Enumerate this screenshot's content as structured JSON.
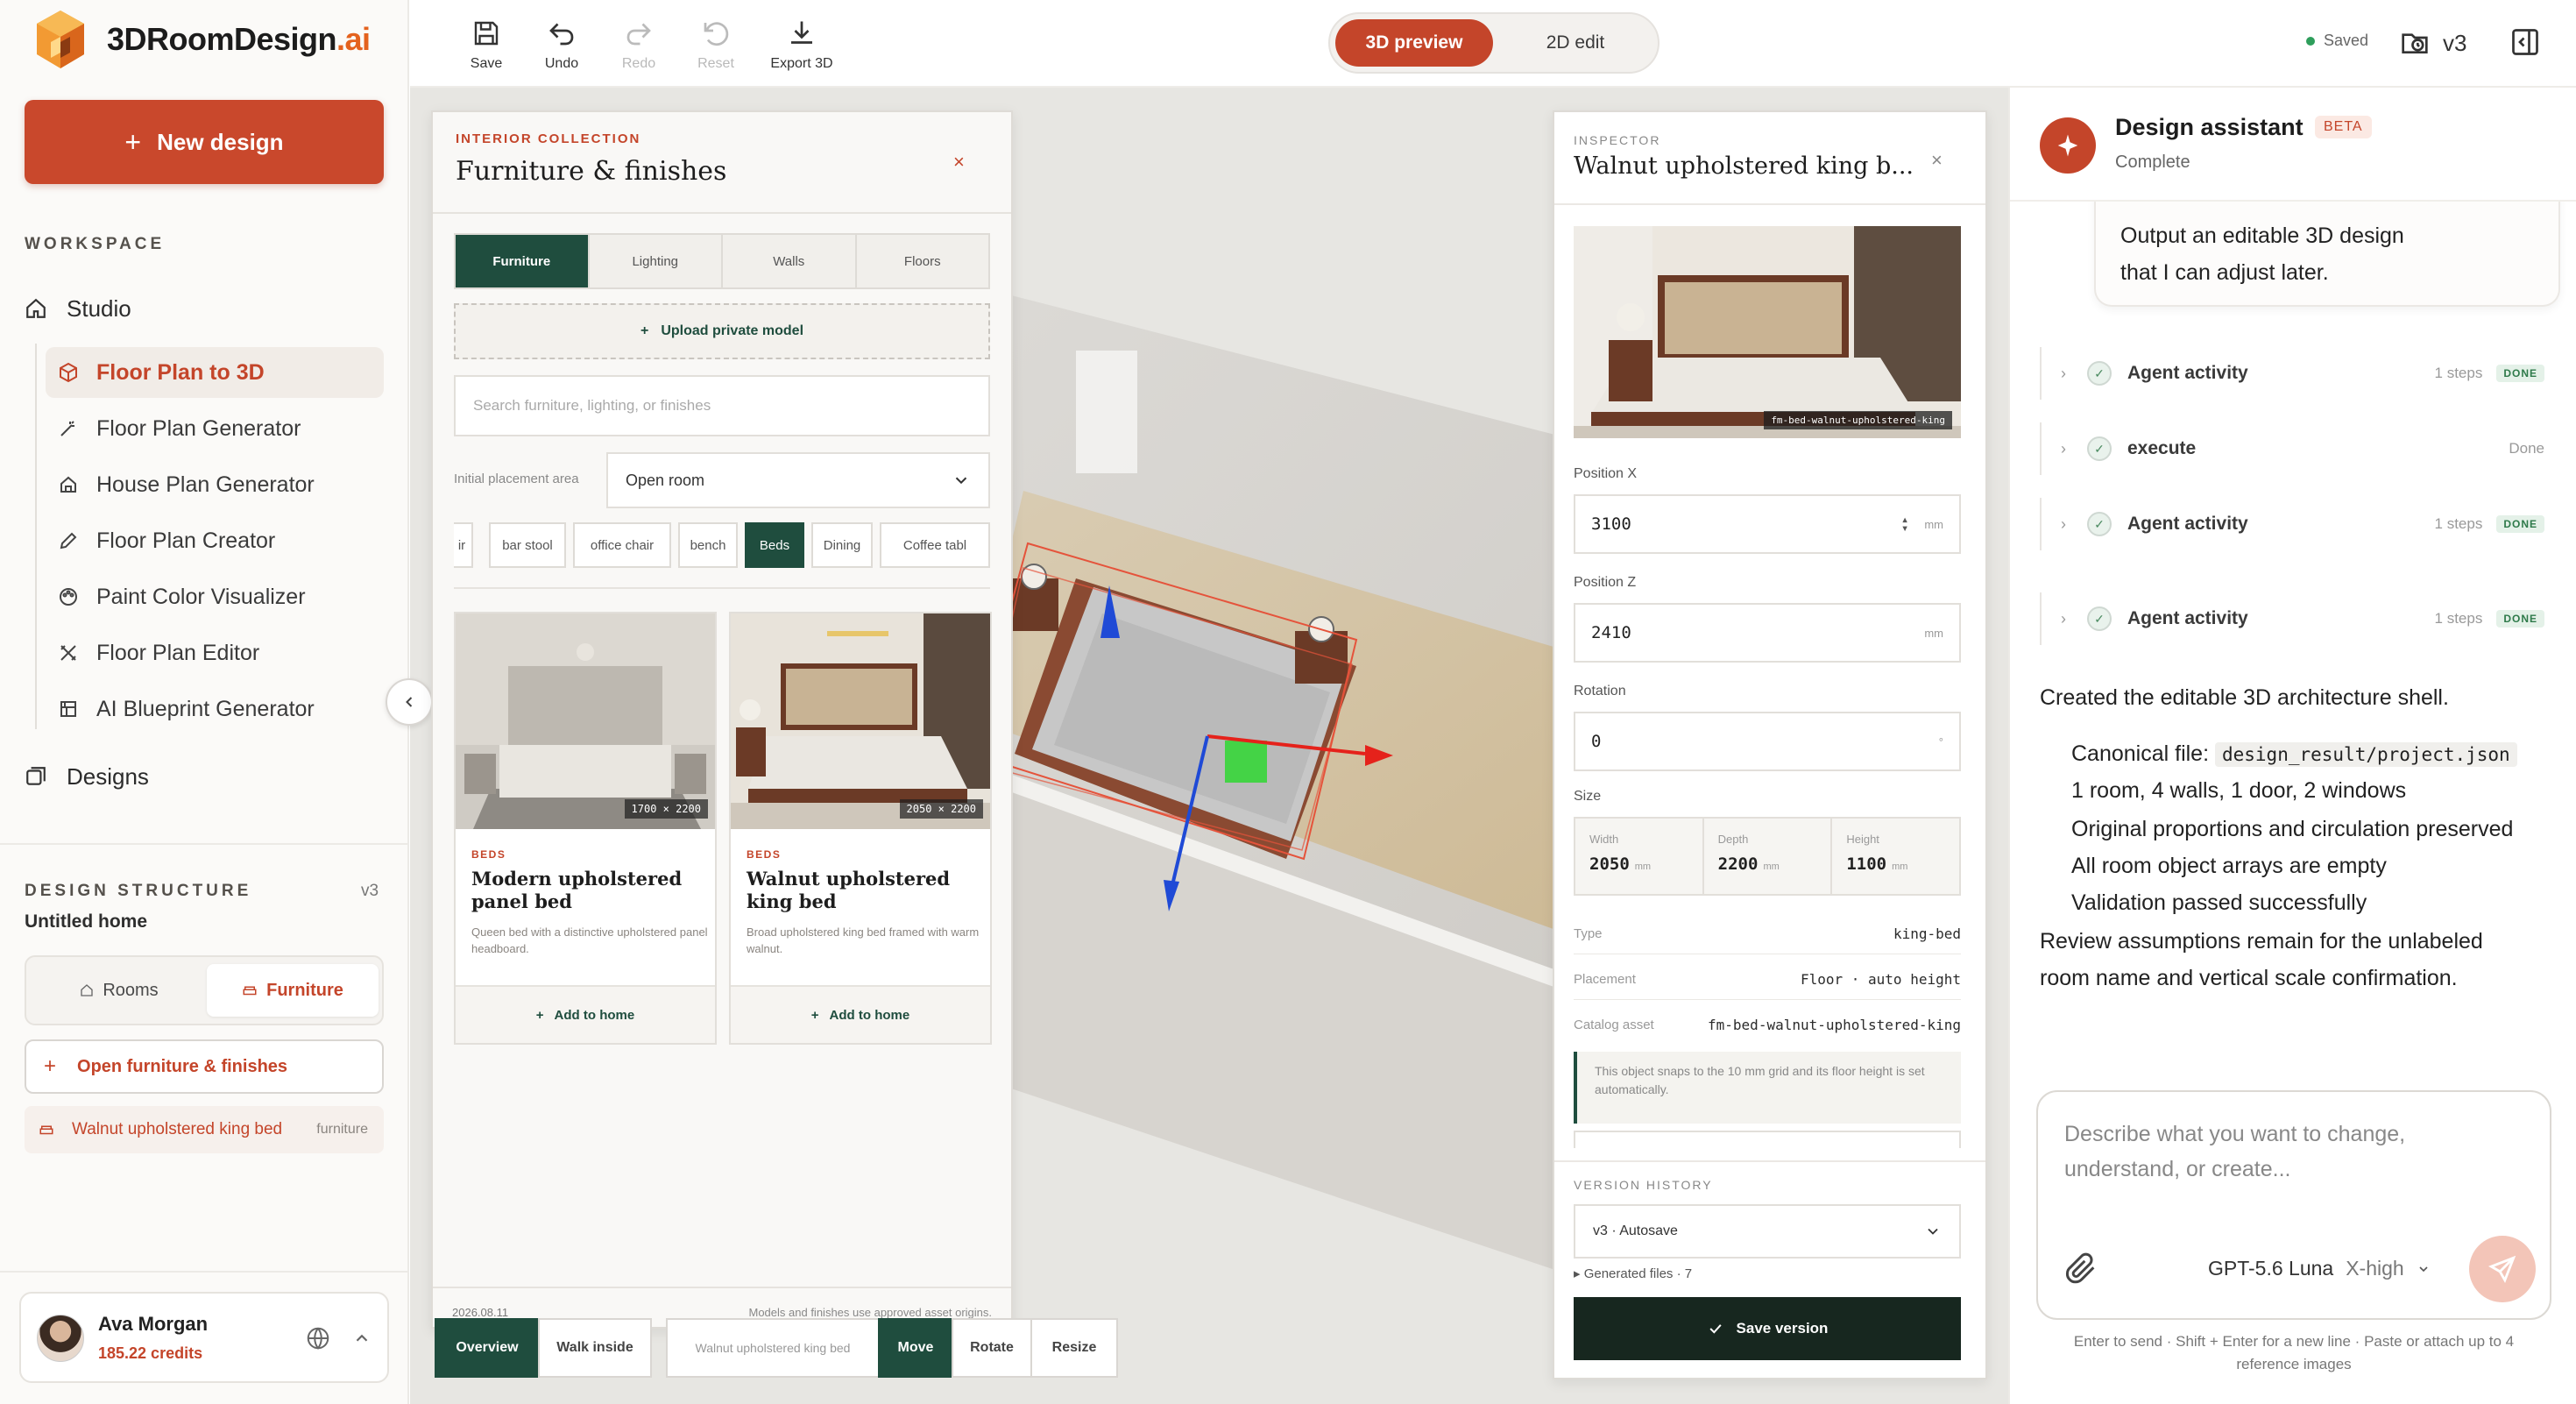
{
  "app": {
    "brand_main": "3DRoomDesign",
    "brand_ai": ".ai"
  },
  "sidebar": {
    "new_design": "New design",
    "workspace_label": "WORKSPACE",
    "studio": "Studio",
    "items": [
      {
        "label": "Floor Plan to 3D",
        "icon": "cube-icon",
        "active": true
      },
      {
        "label": "Floor Plan Generator",
        "icon": "magic-wand-icon"
      },
      {
        "label": "House Plan Generator",
        "icon": "house-icon"
      },
      {
        "label": "Floor Plan Creator",
        "icon": "pencil-icon"
      },
      {
        "label": "Paint Color Visualizer",
        "icon": "palette-icon"
      },
      {
        "label": "Floor Plan Editor",
        "icon": "edit-tools-icon"
      },
      {
        "label": "AI Blueprint Generator",
        "icon": "blueprint-icon"
      }
    ],
    "designs": "Designs",
    "structure_label": "DESIGN STRUCTURE",
    "structure_version": "v3",
    "home_name": "Untitled home",
    "seg_rooms": "Rooms",
    "seg_furniture": "Furniture",
    "open_ff": "Open furniture & finishes",
    "struct_item": "Walnut upholstered king bed",
    "struct_item_tag": "furniture",
    "user_name": "Ava Morgan",
    "user_credits": "185.22 credits"
  },
  "toolbar": {
    "save": "Save",
    "undo": "Undo",
    "redo": "Redo",
    "reset": "Reset",
    "export": "Export 3D",
    "mode_3d": "3D preview",
    "mode_2d": "2D edit",
    "saved": "Saved",
    "version": "v3"
  },
  "catalog": {
    "kicker": "INTERIOR COLLECTION",
    "title": "Furniture & finishes",
    "close": "×",
    "tabs": [
      "Furniture",
      "Lighting",
      "Walls",
      "Floors"
    ],
    "upload": "Upload private model",
    "search_placeholder": "Search furniture, lighting, or finishes",
    "placement_label": "Initial placement area",
    "placement_value": "Open room",
    "chips": [
      "ir",
      "bar stool",
      "office chair",
      "bench",
      "Beds",
      "Dining",
      "Coffee tabl"
    ],
    "cards": [
      {
        "dims": "1700 × 2200",
        "kicker": "BEDS",
        "title": "Modern upholstered panel bed",
        "desc": "Queen bed with a distinctive upholstered panel headboard.",
        "add": "Add to home"
      },
      {
        "dims": "2050 × 2200",
        "kicker": "BEDS",
        "title": "Walnut upholstered king bed",
        "desc": "Broad upholstered king bed framed with warm walnut.",
        "add": "Add to home"
      }
    ],
    "date": "2026.08.11",
    "note": "Models and finishes use approved asset origins."
  },
  "viewport_controls": {
    "overview": "Overview",
    "walk": "Walk inside",
    "selected": "Walnut upholstered king bed",
    "move": "Move",
    "rotate": "Rotate",
    "resize": "Resize"
  },
  "inspector": {
    "kicker": "INSPECTOR",
    "title": "Walnut upholstered king b...",
    "close": "×",
    "asset_tag": "fm-bed-walnut-upholstered-king",
    "pos_x_label": "Position X",
    "pos_x": "3100",
    "pos_z_label": "Position Z",
    "pos_z": "2410",
    "rot_label": "Rotation",
    "rot": "0",
    "unit_mm": "mm",
    "unit_deg": "°",
    "size_label": "Size",
    "width_label": "Width",
    "width": "2050",
    "depth_label": "Depth",
    "depth": "2200",
    "height_label": "Height",
    "height": "1100",
    "type_label": "Type",
    "type": "king-bed",
    "placement_label": "Placement",
    "placement": "Floor · auto height",
    "catalog_label": "Catalog asset",
    "catalog": "fm-bed-walnut-upholstered-king",
    "note": "This object snaps to the 10 mm grid and its floor height is set automatically.",
    "vh_label": "VERSION HISTORY",
    "vh_value": "v3 · Autosave",
    "gen_files": "▸ Generated files · 7",
    "save_version": "Save version"
  },
  "assistant": {
    "title": "Design assistant",
    "beta": "BETA",
    "status": "Complete",
    "bubble_l1": "Output an editable 3D design",
    "bubble_l2": "that I can adjust later.",
    "activities": [
      {
        "label": "Agent activity",
        "steps": "1 steps",
        "badge": "DONE"
      },
      {
        "label": "execute",
        "status": "Done"
      },
      {
        "label": "Agent activity",
        "steps": "1 steps",
        "badge": "DONE"
      },
      {
        "label": "Agent activity",
        "steps": "1 steps",
        "badge": "DONE"
      }
    ],
    "msg_intro": "Created the editable 3D architecture shell.",
    "msg_canon_label": "Canonical file:",
    "msg_canon_file": "design_result/project.json",
    "msg_lines": [
      "1 room, 4 walls, 1 door, 2 windows",
      "Original proportions and circulation preserved",
      "All room object arrays are empty",
      "Validation passed successfully"
    ],
    "msg_review_l1": "Review assumptions remain for the unlabeled",
    "msg_review_l2": "room name and vertical scale confirmation.",
    "composer_placeholder": "Describe what you want to change, understand, or create...",
    "model": "GPT-5.6 Luna",
    "effort": "X-high",
    "hint_l1": "Enter to send · Shift + Enter for a new line · Paste or attach up to 4",
    "hint_l2": "reference images"
  },
  "colors": {
    "accent": "#c4452a",
    "forest": "#1f4d3e",
    "dark": "#17271f"
  }
}
